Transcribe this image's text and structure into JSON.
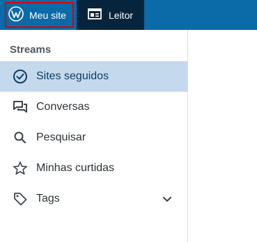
{
  "topbar": {
    "my_site": {
      "label": "Meu site",
      "icon": "wordpress-icon"
    },
    "reader": {
      "label": "Leitor",
      "icon": "reader-icon"
    }
  },
  "sidebar": {
    "section_title": "Streams",
    "items": [
      {
        "label": "Sites seguidos",
        "icon": "check-circle-icon",
        "selected": true
      },
      {
        "label": "Conversas",
        "icon": "conversation-icon"
      },
      {
        "label": "Pesquisar",
        "icon": "search-icon"
      },
      {
        "label": "Minhas curtidas",
        "icon": "star-icon"
      },
      {
        "label": "Tags",
        "icon": "tag-icon",
        "expandable": true
      }
    ]
  },
  "colors": {
    "masterbar": "#0b6aa8",
    "masterbar_active": "#06253d",
    "selected_row": "#c5d9ed",
    "annotation": "#e00000"
  }
}
